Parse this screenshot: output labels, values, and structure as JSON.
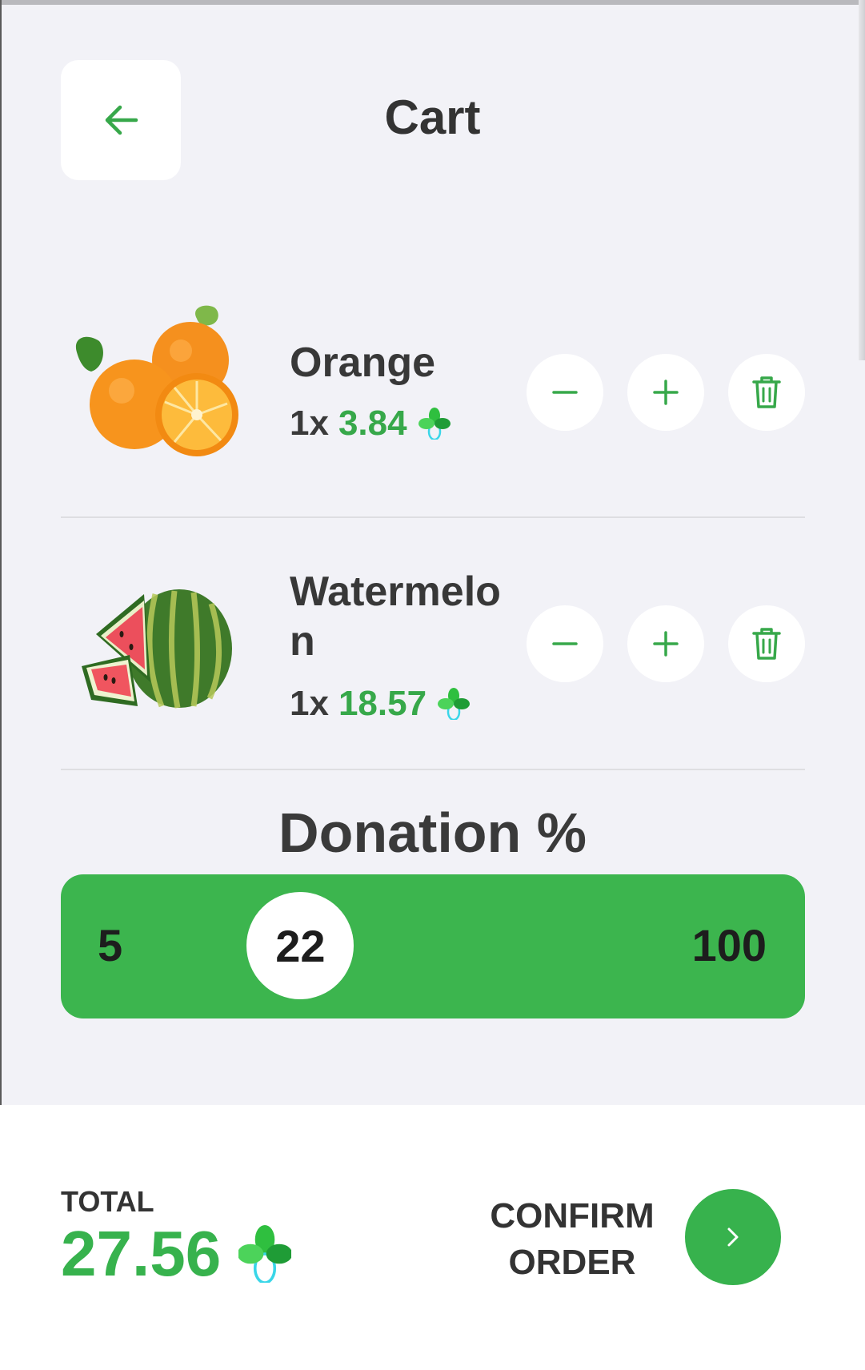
{
  "header": {
    "title": "Cart"
  },
  "cart": {
    "items": [
      {
        "name": "Orange",
        "quantity": "1x",
        "price": "3.84"
      },
      {
        "name": "Watermelon",
        "quantity": "1x",
        "price": "18.57"
      }
    ]
  },
  "donation": {
    "title": "Donation %",
    "min": "5",
    "max": "100",
    "value": "22",
    "value_fraction": 0.18
  },
  "footer": {
    "total_label": "TOTAL",
    "total_value": "27.56",
    "confirm_label": "CONFIRM ORDER"
  },
  "colors": {
    "accent": "#37b24d",
    "background": "#f2f2f7",
    "text": "#333333"
  },
  "icons": {
    "back": "arrow-left-icon",
    "minus": "minus-icon",
    "plus": "plus-icon",
    "delete": "trash-icon",
    "currency": "leaf-coin-icon",
    "next": "chevron-right-icon"
  }
}
